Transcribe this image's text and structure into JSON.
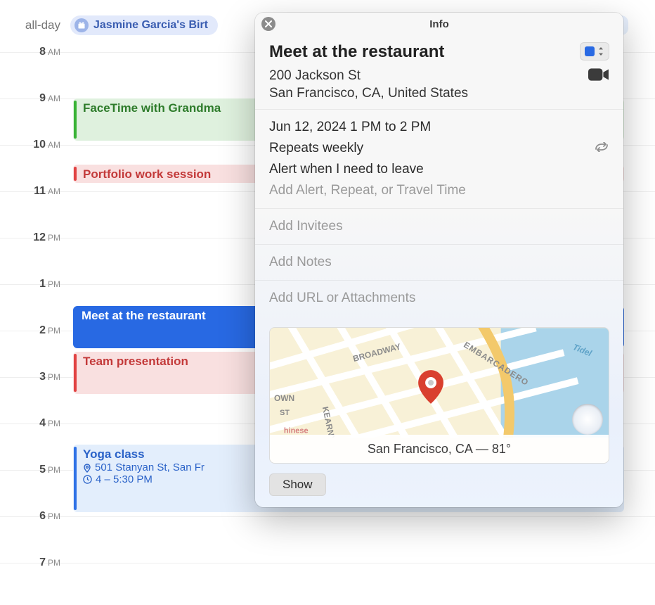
{
  "allday": {
    "label": "all-day",
    "event_title": "Jasmine Garcia's Birthday",
    "visible_title": "Jasmine Garcia's Birt"
  },
  "hours": [
    {
      "num": "8",
      "ampm": "AM"
    },
    {
      "num": "9",
      "ampm": "AM"
    },
    {
      "num": "10",
      "ampm": "AM"
    },
    {
      "num": "11",
      "ampm": "AM"
    },
    {
      "num": "12",
      "ampm": "PM"
    },
    {
      "num": "1",
      "ampm": "PM"
    },
    {
      "num": "2",
      "ampm": "PM"
    },
    {
      "num": "3",
      "ampm": "PM"
    },
    {
      "num": "4",
      "ampm": "PM"
    },
    {
      "num": "5",
      "ampm": "PM"
    },
    {
      "num": "6",
      "ampm": "PM"
    },
    {
      "num": "7",
      "ampm": "PM"
    }
  ],
  "events": {
    "facetime": {
      "title": "FaceTime with Grandma"
    },
    "portfolio": {
      "title": "Portfolio work session"
    },
    "meet": {
      "title": "Meet at the restaurant"
    },
    "team": {
      "title": "Team presentation"
    },
    "yoga": {
      "title": "Yoga class",
      "location": "501 Stanyan St, San Fr",
      "time": "4 – 5:30 PM"
    }
  },
  "popover": {
    "title": "Info",
    "event_title": "Meet at the restaurant",
    "location_line1": "200 Jackson St",
    "location_line2": "San Francisco, CA, United States",
    "datetime": "Jun 12, 2024  1 PM to 2 PM",
    "repeat": "Repeats weekly",
    "alert": "Alert when I need to leave",
    "add_alert": "Add Alert, Repeat, or Travel Time",
    "add_invitees": "Add Invitees",
    "add_notes": "Add Notes",
    "add_url": "Add URL or Attachments",
    "map_caption": "San Francisco, CA — 81°",
    "map_street_1": "BROADWAY",
    "map_street_2": "KEARNY",
    "map_area_1": "EMBARCADERO",
    "map_area_2": "OWN",
    "map_label_st": "ST",
    "map_label_tidel": "Tidel",
    "map_label_chinese": "hinese",
    "show_label": "Show",
    "calendar_color": "#2869e3"
  }
}
